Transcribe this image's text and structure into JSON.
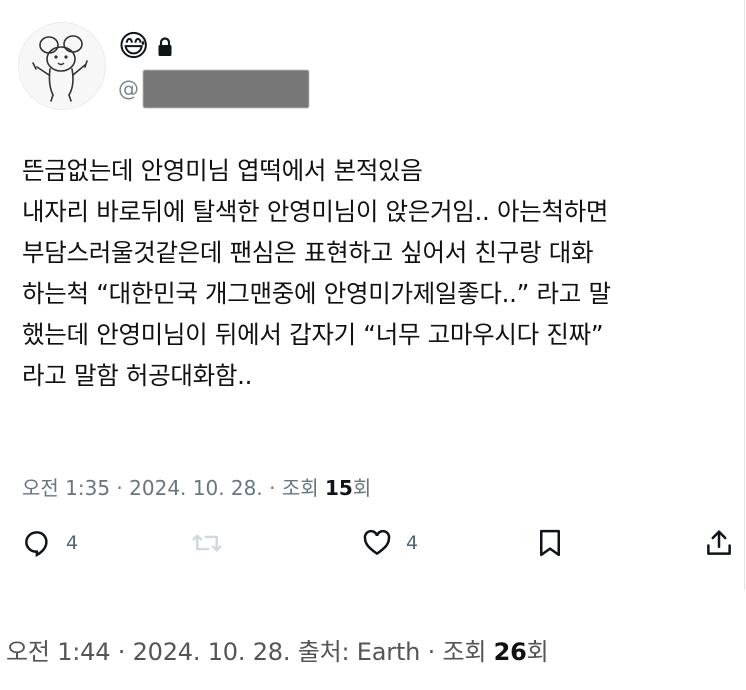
{
  "tweet": {
    "display_name_emoji": "😅",
    "handle_prefix": "@",
    "lines": [
      "뜬금없는데 안영미님 엽떡에서 본적있음",
      "내자리 바로뒤에 탈색한 안영미님이 앉은거임.. 아는척하면",
      "부담스러울것같은데 팬심은 표현하고 싶어서 친구랑 대화",
      "하는척 “대한민국 개그맨중에 안영미가제일좋다..” 라고 말",
      "했는데 안영미님이 뒤에서 갑자기 “너무 고마우시다 진짜”",
      "라고 말함 허공대화함.."
    ],
    "meta": {
      "time": "오전 1:35",
      "sep1": " · ",
      "date": "2024. 10. 28.",
      "sep2": " · ",
      "views_label": "조회 ",
      "views_count": "15",
      "views_suffix": "회"
    },
    "actions": {
      "reply_count": "4",
      "like_count": "4"
    }
  },
  "footer": {
    "time": "오전 1:44",
    "sep1": " · ",
    "date": "2024. 10. 28.",
    "source": " 출처: Earth",
    "sep2": " · ",
    "views_label": "조회 ",
    "views_count": "26",
    "views_suffix": "회"
  },
  "icons": {
    "reply": "reply-icon",
    "retweet": "retweet-icon",
    "like": "heart-icon",
    "bookmark": "bookmark-icon",
    "share": "share-icon",
    "lock": "lock-icon"
  },
  "colors": {
    "icon_gray": "#536471",
    "meta_gray": "#687684",
    "redaction": "#777777"
  }
}
